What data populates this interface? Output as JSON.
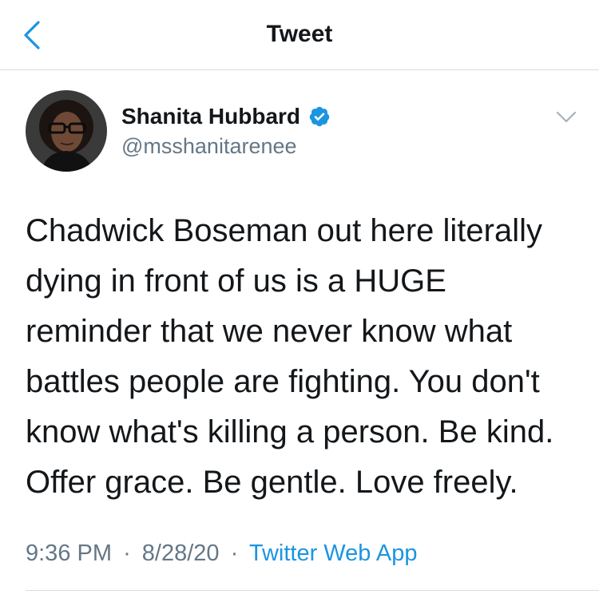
{
  "header": {
    "title": "Tweet",
    "back_icon": "back-chevron-icon"
  },
  "tweet": {
    "author": {
      "display_name": "Shanita Hubbard",
      "handle": "@msshanitarenee",
      "verified": true
    },
    "text_lines": [
      "Chadwick Boseman out here literally",
      "dying in front of us is a HUGE",
      "reminder that we never know what",
      "battles people are fighting. You don't",
      "know what's killing a person. Be kind.",
      "Offer grace. Be gentle. Love freely."
    ],
    "time": "9:36 PM",
    "date": "8/28/20",
    "separator": "·",
    "source": "Twitter Web App"
  },
  "colors": {
    "accent": "#1b95e0",
    "secondary_text": "#657786",
    "divider": "#d8dde1"
  }
}
